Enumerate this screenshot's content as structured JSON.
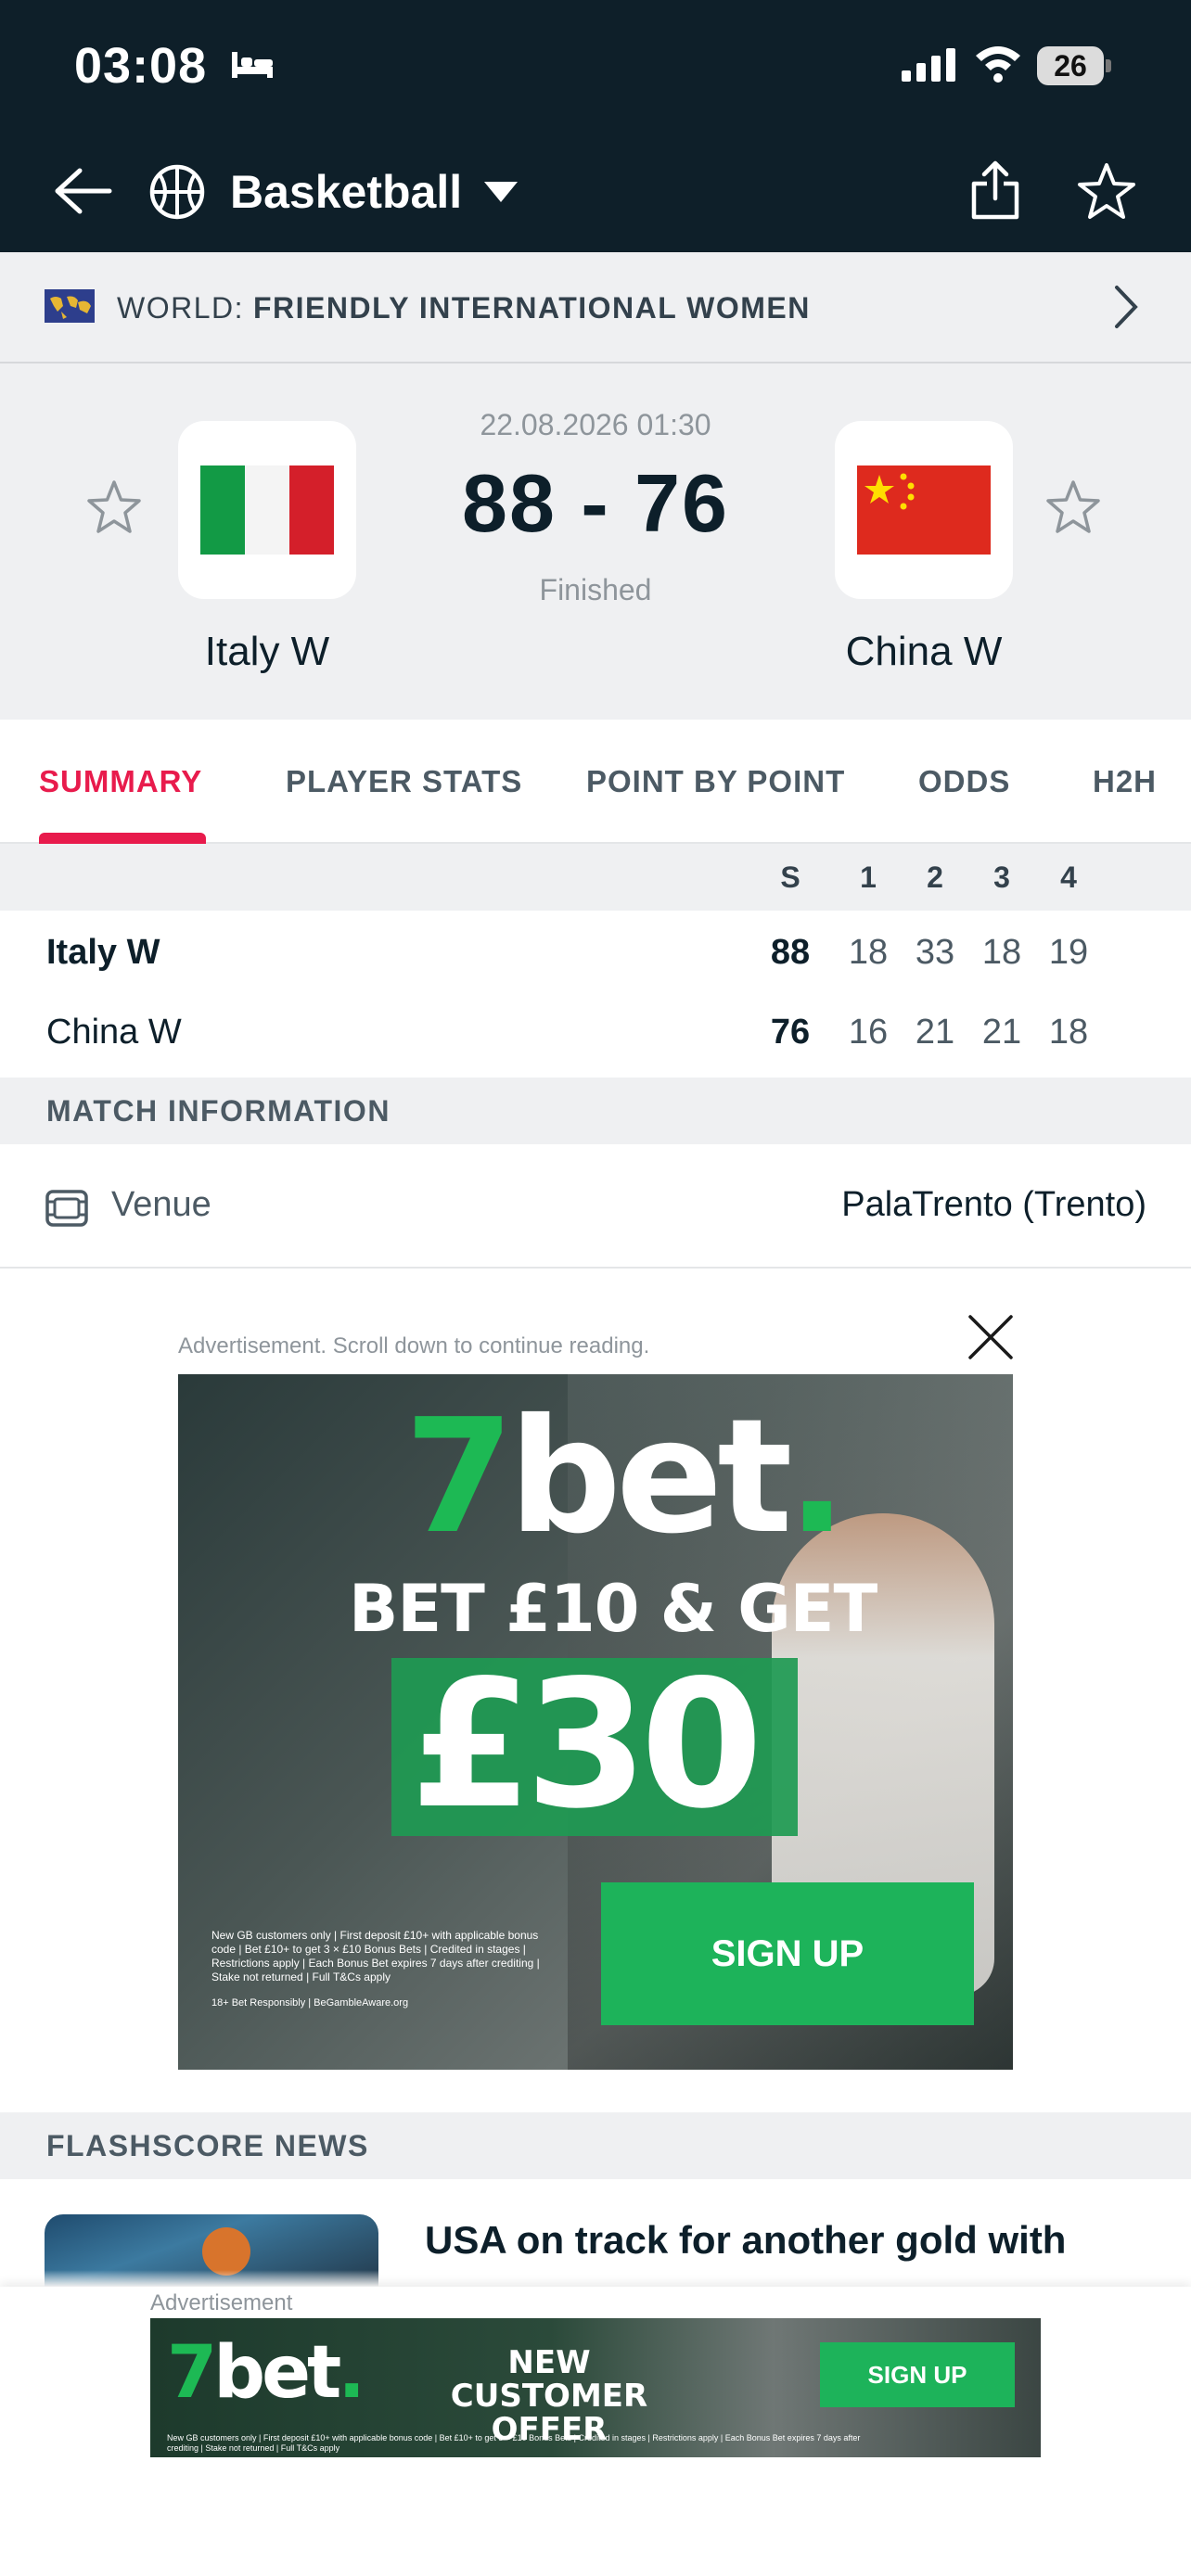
{
  "status_bar": {
    "time": "03:08",
    "battery": "26"
  },
  "header": {
    "sport": "Basketball"
  },
  "league": {
    "prefix": "WORLD:",
    "name": "FRIENDLY INTERNATIONAL WOMEN"
  },
  "match": {
    "datetime": "22.08.2026 01:30",
    "score": "88 - 76",
    "status": "Finished",
    "home": {
      "name": "Italy W"
    },
    "away": {
      "name": "China W"
    }
  },
  "tabs": [
    "SUMMARY",
    "PLAYER STATS",
    "POINT BY POINT",
    "ODDS",
    "H2H"
  ],
  "score_table": {
    "columns": [
      "S",
      "1",
      "2",
      "3",
      "4"
    ],
    "rows": [
      {
        "team": "Italy W",
        "total": "88",
        "q1": "18",
        "q2": "33",
        "q3": "18",
        "q4": "19"
      },
      {
        "team": "China W",
        "total": "76",
        "q1": "16",
        "q2": "21",
        "q3": "21",
        "q4": "18"
      }
    ]
  },
  "match_info": {
    "heading": "MATCH INFORMATION",
    "venue_label": "Venue",
    "venue_value": "PalaTrento (Trento)"
  },
  "ad": {
    "note": "Advertisement. Scroll down to continue reading.",
    "brand_a": "7",
    "brand_b": "bet",
    "brand_dot": ".",
    "headline": "BET £10 & GET",
    "amount": "£30",
    "signup": "SIGN UP",
    "small_print": "New GB customers only | First deposit £10+ with applicable bonus code | Bet £10+ to get 3 × £10 Bonus Bets | Credited in stages | Restrictions apply | Each Bonus Bet expires 7 days after crediting | Stake not returned | Full T&Cs apply",
    "responsible": "18+ Bet Responsibly | BeGambleAware.org"
  },
  "news": {
    "heading": "FLASHSCORE NEWS",
    "headline": "USA on track for another gold with"
  },
  "sticky_ad": {
    "label": "Advertisement",
    "offer": "NEW CUSTOMER OFFER",
    "signup": "SIGN UP",
    "small_print": "New GB customers only | First deposit £10+ with applicable bonus code | Bet £10+ to get 3 × £10 Bonus Bets | Credited in stages | Restrictions apply | Each Bonus Bet expires 7 days after crediting | Stake not returned | Full T&Cs apply"
  },
  "colors": {
    "header_bg": "#0e1f29",
    "accent": "#e81b4c",
    "ad_green": "#1db35a"
  }
}
